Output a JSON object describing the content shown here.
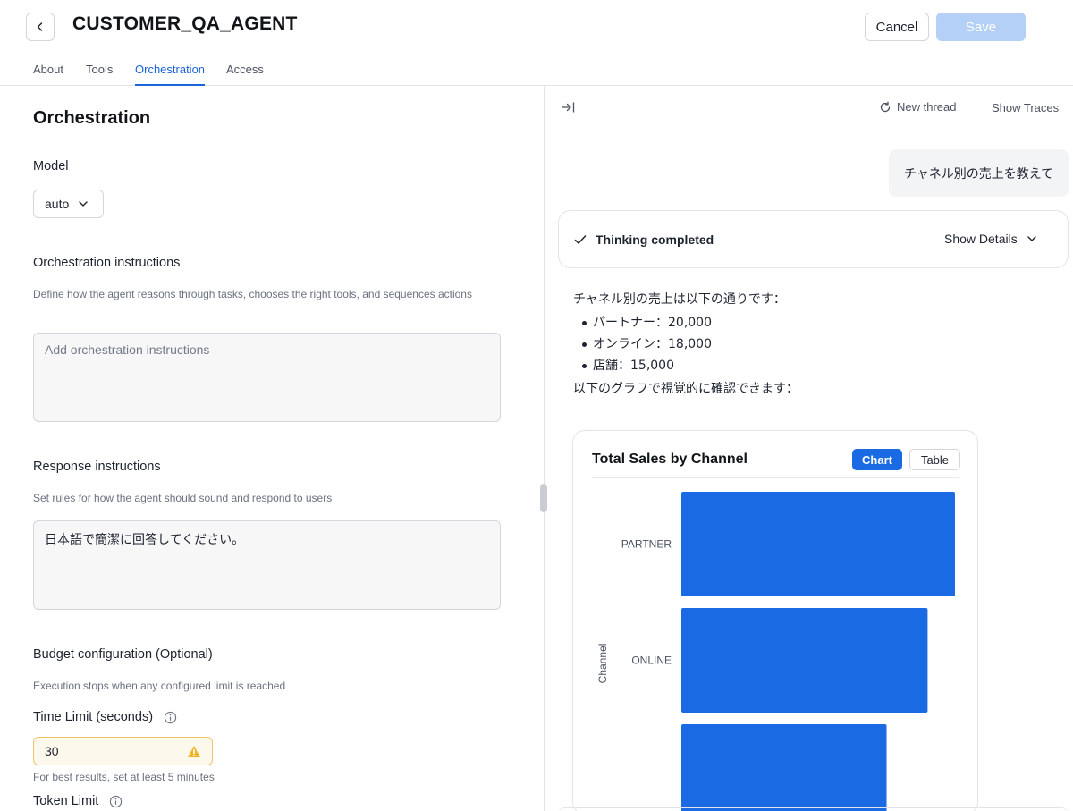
{
  "header": {
    "title": "CUSTOMER_QA_AGENT",
    "cancel_label": "Cancel",
    "save_label": "Save"
  },
  "tabs": [
    {
      "label": "About",
      "active": false
    },
    {
      "label": "Tools",
      "active": false
    },
    {
      "label": "Orchestration",
      "active": true
    },
    {
      "label": "Access",
      "active": false
    }
  ],
  "left": {
    "heading": "Orchestration",
    "model": {
      "label": "Model",
      "value": "auto"
    },
    "orchestration_instructions": {
      "label": "Orchestration instructions",
      "hint": "Define how the agent reasons through tasks, chooses the right tools, and sequences actions",
      "placeholder": "Add orchestration instructions",
      "value": ""
    },
    "response_instructions": {
      "label": "Response instructions",
      "hint": "Set rules for how the agent should sound and respond to users",
      "value": "日本語で簡潔に回答してください。"
    },
    "budget": {
      "label": "Budget configuration (Optional)",
      "hint": "Execution stops when any configured limit is reached",
      "time_limit_label": "Time Limit (seconds)",
      "time_limit_value": "30",
      "time_limit_warning": "For best results, set at least 5 minutes",
      "token_limit_label": "Token Limit"
    }
  },
  "right": {
    "new_thread_label": "New thread",
    "show_traces_label": "Show Traces",
    "user_message": "チャネル別の売上を教えて",
    "thinking": {
      "label": "Thinking completed",
      "details_label": "Show Details"
    },
    "answer": {
      "intro": "チャネル別の売上は以下の通りです：",
      "items": [
        "パートナー：20,000",
        "オンライン：18,000",
        "店舗：15,000"
      ],
      "outro": "以下のグラフで視覚的に確認できます："
    },
    "chart_toggle": {
      "chart_label": "Chart",
      "table_label": "Table",
      "selected": "Chart"
    }
  },
  "colors": {
    "accent": "#1a63d8",
    "bar": "#1a6ae3",
    "save_disabled": "#b5d0f7",
    "warning": "#f0b429"
  },
  "icons": [
    "chevron-left-icon",
    "chevron-down-icon",
    "info-icon",
    "warning-icon",
    "collapse-panel-icon",
    "refresh-icon",
    "check-icon"
  ],
  "chart_data": {
    "type": "bar",
    "orientation": "horizontal",
    "title": "Total Sales by Channel",
    "ylabel": "Channel",
    "categories": [
      "PARTNER",
      "ONLINE",
      ""
    ],
    "values": [
      20000,
      18000,
      15000
    ],
    "xlim": [
      0,
      20000
    ]
  }
}
